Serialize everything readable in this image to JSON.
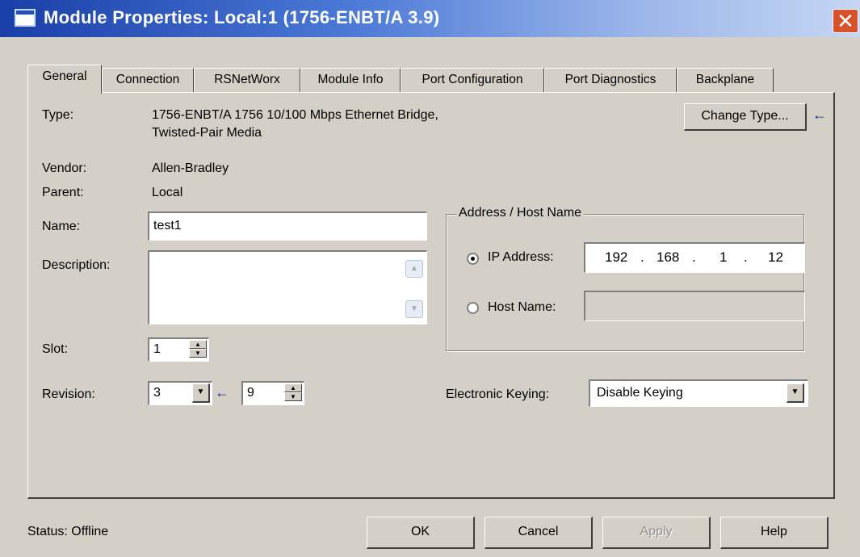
{
  "window": {
    "title": "Module Properties: Local:1 (1756-ENBT/A 3.9)",
    "close_glyph": "✕"
  },
  "tabs": [
    {
      "label": "General"
    },
    {
      "label": "Connection"
    },
    {
      "label": "RSNetWorx"
    },
    {
      "label": "Module Info"
    },
    {
      "label": "Port Configuration"
    },
    {
      "label": "Port Diagnostics"
    },
    {
      "label": "Backplane"
    }
  ],
  "general": {
    "type_label": "Type:",
    "type_value_line1": "1756-ENBT/A 1756 10/100 Mbps Ethernet Bridge,",
    "type_value_line2": "Twisted-Pair Media",
    "change_type_button": "Change Type...",
    "vendor_label": "Vendor:",
    "vendor_value": "Allen-Bradley",
    "parent_label": "Parent:",
    "parent_value": "Local",
    "name_label": "Name:",
    "name_value": "test1",
    "description_label": "Description:",
    "description_value": "",
    "slot_label": "Slot:",
    "slot_value": "1",
    "revision_label": "Revision:",
    "revision_major": "3",
    "revision_minor": "9",
    "address_group_title": "Address / Host Name",
    "ip_address_label": "IP Address:",
    "ip_address_selected": true,
    "ip_octets": [
      "192",
      "168",
      "1",
      "12"
    ],
    "ip_separator": ".",
    "host_name_label": "Host Name:",
    "host_name_value": "",
    "electronic_keying_label": "Electronic Keying:",
    "electronic_keying_value": "Disable Keying"
  },
  "footer": {
    "status_text": "Status:  Offline",
    "ok": "OK",
    "cancel": "Cancel",
    "apply": "Apply",
    "help": "Help"
  },
  "icons": {
    "indicator_arrow": "←"
  },
  "colors": {
    "title_bar": "#1a3fa8",
    "close_button": "#d6522c",
    "indicator_arrow": "#1c2c8c"
  }
}
